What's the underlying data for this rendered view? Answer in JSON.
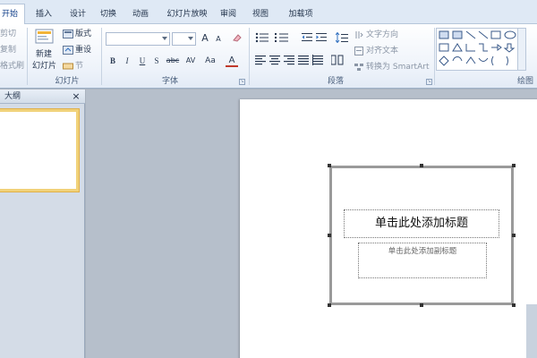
{
  "tabs": [
    "开始",
    "插入",
    "设计",
    "切换",
    "动画",
    "幻灯片放映",
    "审阅",
    "视图",
    "加载项"
  ],
  "clipboard": {
    "cut": "剪切",
    "copy": "复制",
    "format_painter": "格式刷"
  },
  "slides_group": {
    "new_slide_top": "新建",
    "new_slide_bottom": "幻灯片",
    "layout": "版式",
    "reset": "重设",
    "section": "节",
    "label": "幻灯片"
  },
  "font_group": {
    "label": "字体",
    "bold": "B",
    "italic": "I",
    "underline": "U",
    "shadow": "S",
    "strike": "abc",
    "spacing": "AV",
    "case": "Aa",
    "color": "A",
    "grow": "A",
    "shrink": "A"
  },
  "paragraph_group": {
    "label": "段落",
    "text_direction": "文字方向",
    "align_text": "对齐文本",
    "convert_smartart": "转换为 SmartArt"
  },
  "drawing_group": {
    "label": "绘图"
  },
  "outline_pane": {
    "tab_label": "大纲",
    "close": "×"
  },
  "slide": {
    "title_placeholder": "单击此处添加标题",
    "subtitle_placeholder": "单击此处添加副标题"
  },
  "colors": {
    "ribbon_bg": "#eef3fa",
    "tab_bar": "#dfe9f5",
    "selection_border": "#f1d27a",
    "editor_bg": "#b6bfcb"
  }
}
